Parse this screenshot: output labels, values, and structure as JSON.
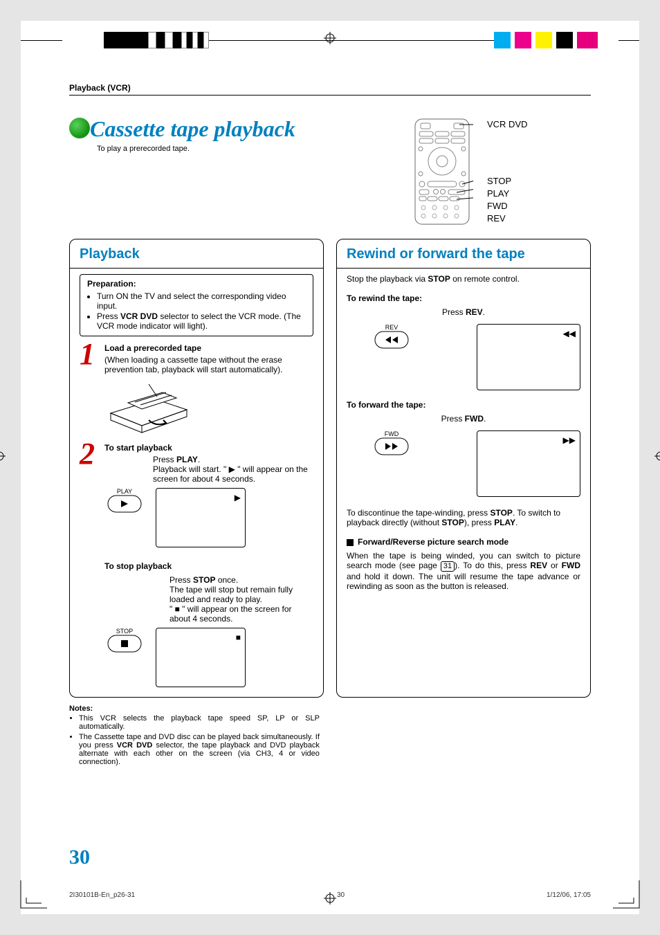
{
  "section_header": "Playback (VCR)",
  "title": "Cassette tape playback",
  "subtitle": "To play a prerecorded tape.",
  "remote": {
    "label_top": "VCR DVD",
    "label_stop": "STOP",
    "label_play": "PLAY",
    "label_fwd": "FWD",
    "label_rev": "REV"
  },
  "left": {
    "heading": "Playback",
    "prep": {
      "heading": "Preparation:",
      "item1": "Turn ON the TV and select the corresponding video input.",
      "item2_pre": "Press ",
      "item2_bold": "VCR DVD",
      "item2_post": " selector to select the VCR mode. (The VCR mode indicator will light)."
    },
    "step1": {
      "num": "1",
      "title": "Load a prerecorded tape",
      "note": "(When loading a cassette tape without the erase prevention tab, playback will start automatically)."
    },
    "step2": {
      "num": "2",
      "title": "To start playback",
      "press_pre": "Press ",
      "press_bold": "PLAY",
      "press_post": ".",
      "line2_pre": "Playback will start. \" ",
      "line2_post": " \" will appear on the screen for about 4 seconds.",
      "btn_label": "PLAY"
    },
    "stop": {
      "title": "To stop playback",
      "press_pre": "Press ",
      "press_bold": "STOP",
      "press_post": " once.",
      "line2": "The tape will stop but remain fully loaded and ready to play.",
      "line3_pre": "\" ",
      "line3_post": " \" will appear on the screen for about 4 seconds.",
      "btn_label": "STOP"
    },
    "notes": {
      "heading": "Notes:",
      "n1": "This VCR selects the playback tape speed SP, LP or SLP automatically.",
      "n2_pre": "The Cassette tape and DVD disc can be played back simultaneously. If you press ",
      "n2_bold": "VCR DVD",
      "n2_post": " selector, the tape playback and DVD playback alternate with each other on the screen (via CH3, 4 or video connection)."
    }
  },
  "right": {
    "heading": "Rewind or forward the tape",
    "intro_pre": "Stop the playback via ",
    "intro_bold": "STOP",
    "intro_post": " on remote control.",
    "rewind": {
      "heading": "To rewind the tape:",
      "press_pre": "Press ",
      "press_bold": "REV",
      "press_post": ".",
      "btn_label": "REV"
    },
    "forward": {
      "heading": "To forward the tape:",
      "press_pre": "Press ",
      "press_bold": "FWD",
      "press_post": ".",
      "btn_label": "FWD"
    },
    "discont_pre": "To discontinue the tape-winding, press ",
    "discont_b1": "STOP",
    "discont_mid": ". To switch to playback directly (without ",
    "discont_b2": "STOP",
    "discont_mid2": "), press ",
    "discont_b3": "PLAY",
    "discont_post": ".",
    "search_heading": "Forward/Reverse picture search mode",
    "search_p1": "When the tape is being winded, you can switch to picture search mode (see page ",
    "search_pg": "31",
    "search_p2": "). To do this, press ",
    "search_b1": "REV",
    "search_p3": " or ",
    "search_b2": "FWD",
    "search_p4": " and hold it down. The unit will resume the tape advance or rewinding as soon as the button is released."
  },
  "page_number": "30",
  "footer": {
    "left": "2I30101B-En_p26-31",
    "center": "30",
    "right": "1/12/06, 17:05"
  }
}
